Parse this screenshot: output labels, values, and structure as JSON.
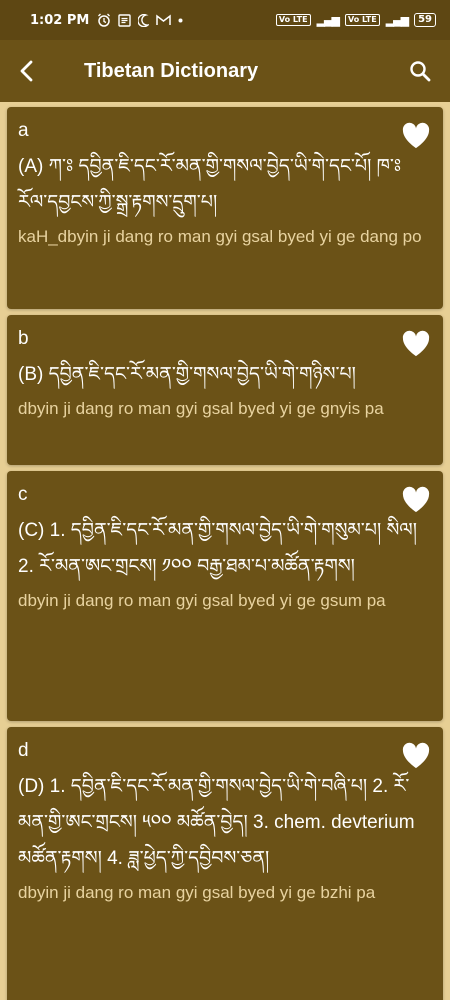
{
  "status_bar": {
    "time": "1:02 PM",
    "icons": [
      "alarm-icon",
      "notes-icon",
      "moon-icon",
      "gmail-icon",
      "dot-icon"
    ],
    "lte_label": "Vo LTE",
    "battery": "59"
  },
  "app_bar": {
    "title": "Tibetan Dictionary",
    "back_icon": "arrow-back-icon",
    "search_icon": "search-icon"
  },
  "entries": [
    {
      "word": "a",
      "meaning": "(A) ཀ་ཿ དབྱིན་ཇི་དང་རོ་མན་གྱི་གསལ་བྱེད་ཡི་གེ་དང་པོ། ཁ་ཿ རོལ་དབྱངས་ཀྱི་སྒྲ་རྟགས་དྲུག་པ།",
      "translit": "kaH_dbyin ji dang ro man gyi gsal byed yi ge dang po"
    },
    {
      "word": "b",
      "meaning": "(B) དབྱིན་ཇི་དང་རོ་མན་གྱི་གསལ་བྱེད་ཡི་གེ་གཉིས་པ།",
      "translit": "dbyin ji dang ro man gyi gsal byed yi ge gnyis pa"
    },
    {
      "word": "c",
      "meaning": "(C) 1. དབྱིན་ཇི་དང་རོ་མན་གྱི་གསལ་བྱེད་ཡི་གེ་གསུམ་པ། སིལ། 2. རོ་མན་ཨང་གྲངས། ༡༠༠ བརྒྱ་ཐམ་པ་མཚོན་རྟགས།",
      "translit": "dbyin ji dang ro man gyi gsal byed yi ge gsum pa"
    },
    {
      "word": "d",
      "meaning": "(D) 1. དབྱིན་ཇི་དང་རོ་མན་གྱི་གསལ་བྱེད་ཡི་གེ་བཞི་པ། 2. རོ་མན་གྱི་ཨང་གྲངས། ༥༠༠ མཚོན་བྱེད། 3. chem. devterium མཚོན་རྟགས། 4. ཟླ་ཕྱེད་ཀྱི་དབྱིབས་ཅན།",
      "translit": "dbyin ji dang ro man gyi gsal byed yi ge bzhi pa"
    }
  ],
  "colors": {
    "background": "#e7cf94",
    "card": "#6b5217",
    "app_bar": "#6b5217",
    "status_bar": "#5e4713",
    "translit_text": "#e8d3a0"
  }
}
